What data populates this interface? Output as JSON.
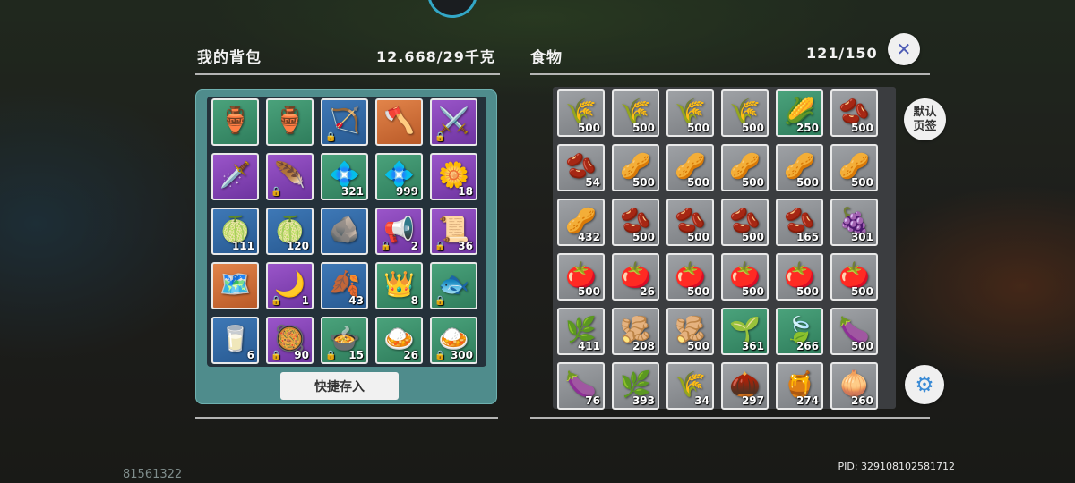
{
  "bag": {
    "title": "我的背包",
    "weight": "12.668/29千克",
    "quick_store_label": "快捷存入",
    "items": [
      {
        "name": "waterskin-icon",
        "icon": "🏺",
        "bg": "green",
        "count": "",
        "lock": false
      },
      {
        "name": "waterskin-icon",
        "icon": "🏺",
        "bg": "green",
        "count": "",
        "lock": false
      },
      {
        "name": "bow-icon",
        "icon": "🏹",
        "bg": "blue",
        "count": "",
        "lock": true
      },
      {
        "name": "axe-icon",
        "icon": "🪓",
        "bg": "orange",
        "count": "",
        "lock": false
      },
      {
        "name": "scythe-icon",
        "icon": "⚔️",
        "bg": "purple",
        "count": "",
        "lock": true
      },
      {
        "name": "crossbow-icon",
        "icon": "🗡️",
        "bg": "purple",
        "count": "",
        "lock": false
      },
      {
        "name": "feather-blade-icon",
        "icon": "🪶",
        "bg": "purple",
        "count": "",
        "lock": true
      },
      {
        "name": "green-gem-icon",
        "icon": "💠",
        "bg": "green",
        "count": "321",
        "lock": false
      },
      {
        "name": "green-gem-icon",
        "icon": "💠",
        "bg": "green",
        "count": "999",
        "lock": false
      },
      {
        "name": "yellow-flower-icon",
        "icon": "🌼",
        "bg": "purple",
        "count": "18",
        "lock": false
      },
      {
        "name": "gray-melon-icon",
        "icon": "🍈",
        "bg": "blue",
        "count": "111",
        "lock": false
      },
      {
        "name": "cantaloupe-icon",
        "icon": "🍈",
        "bg": "blue",
        "count": "120",
        "lock": false
      },
      {
        "name": "stone-icon",
        "icon": "🪨",
        "bg": "blue",
        "count": "",
        "lock": false
      },
      {
        "name": "megaphone-icon",
        "icon": "📢",
        "bg": "purple",
        "count": "2",
        "lock": true
      },
      {
        "name": "scroll-icon",
        "icon": "📜",
        "bg": "purple",
        "count": "36",
        "lock": true
      },
      {
        "name": "treasure-map-icon",
        "icon": "🗺️",
        "bg": "orange",
        "count": "",
        "lock": false
      },
      {
        "name": "sickle-icon",
        "icon": "🌙",
        "bg": "purple",
        "count": "1",
        "lock": true
      },
      {
        "name": "leaf-icon",
        "icon": "🍂",
        "bg": "blue",
        "count": "43",
        "lock": false
      },
      {
        "name": "thorn-crown-icon",
        "icon": "👑",
        "bg": "green",
        "count": "8",
        "lock": false
      },
      {
        "name": "blue-fish-icon",
        "icon": "🐟",
        "bg": "green",
        "count": "",
        "lock": true
      },
      {
        "name": "milk-bottle-icon",
        "icon": "🥛",
        "bg": "blue",
        "count": "6",
        "lock": false
      },
      {
        "name": "stew-bowl-icon",
        "icon": "🥘",
        "bg": "purple",
        "count": "90",
        "lock": true
      },
      {
        "name": "soup-bowl-icon",
        "icon": "🍲",
        "bg": "green",
        "count": "15",
        "lock": true
      },
      {
        "name": "curry-bowl-icon",
        "icon": "🍛",
        "bg": "green",
        "count": "26",
        "lock": false
      },
      {
        "name": "curry-bowl-icon",
        "icon": "🍛",
        "bg": "green",
        "count": "300",
        "lock": true
      }
    ]
  },
  "food": {
    "title": "食物",
    "capacity": "121/150",
    "default_tab_label": "默认页签",
    "items": [
      {
        "name": "wheat-icon",
        "icon": "🌾",
        "bg": "gray",
        "count": "500"
      },
      {
        "name": "wheat-icon",
        "icon": "🌾",
        "bg": "gray",
        "count": "500"
      },
      {
        "name": "wheat-icon",
        "icon": "🌾",
        "bg": "gray",
        "count": "500"
      },
      {
        "name": "wheat-icon",
        "icon": "🌾",
        "bg": "gray",
        "count": "500"
      },
      {
        "name": "corn-icon",
        "icon": "🌽",
        "bg": "green",
        "count": "250"
      },
      {
        "name": "red-beans-plate-icon",
        "icon": "🫘",
        "bg": "gray",
        "count": "500"
      },
      {
        "name": "red-beans-plate-icon",
        "icon": "🫘",
        "bg": "gray",
        "count": "54"
      },
      {
        "name": "soybeans-plate-icon",
        "icon": "🥜",
        "bg": "gray",
        "count": "500"
      },
      {
        "name": "soybeans-plate-icon",
        "icon": "🥜",
        "bg": "gray",
        "count": "500"
      },
      {
        "name": "soybeans-plate-icon",
        "icon": "🥜",
        "bg": "gray",
        "count": "500"
      },
      {
        "name": "soybeans-plate-icon",
        "icon": "🥜",
        "bg": "gray",
        "count": "500"
      },
      {
        "name": "soybeans-plate-icon",
        "icon": "🥜",
        "bg": "gray",
        "count": "500"
      },
      {
        "name": "soybeans-plate-icon",
        "icon": "🥜",
        "bg": "gray",
        "count": "432"
      },
      {
        "name": "red-beans-plate-icon",
        "icon": "🫘",
        "bg": "gray",
        "count": "500"
      },
      {
        "name": "red-beans-plate-icon",
        "icon": "🫘",
        "bg": "gray",
        "count": "500"
      },
      {
        "name": "red-beans-plate-icon",
        "icon": "🫘",
        "bg": "gray",
        "count": "500"
      },
      {
        "name": "red-beans-plate-icon",
        "icon": "🫘",
        "bg": "gray",
        "count": "165"
      },
      {
        "name": "grapes-icon",
        "icon": "🍇",
        "bg": "gray",
        "count": "301"
      },
      {
        "name": "tomato-icon",
        "icon": "🍅",
        "bg": "gray",
        "count": "500"
      },
      {
        "name": "tomato-icon",
        "icon": "🍅",
        "bg": "gray",
        "count": "26"
      },
      {
        "name": "tomato-icon",
        "icon": "🍅",
        "bg": "gray",
        "count": "500"
      },
      {
        "name": "tomato-icon",
        "icon": "🍅",
        "bg": "gray",
        "count": "500"
      },
      {
        "name": "tomato-icon",
        "icon": "🍅",
        "bg": "gray",
        "count": "500"
      },
      {
        "name": "tomato-icon",
        "icon": "🍅",
        "bg": "gray",
        "count": "500"
      },
      {
        "name": "lemongrass-icon",
        "icon": "🌿",
        "bg": "gray",
        "count": "411"
      },
      {
        "name": "ginger-icon",
        "icon": "🫚",
        "bg": "gray",
        "count": "208"
      },
      {
        "name": "ginger-icon",
        "icon": "🫚",
        "bg": "gray",
        "count": "500"
      },
      {
        "name": "mint-icon",
        "icon": "🌱",
        "bg": "green",
        "count": "361"
      },
      {
        "name": "basil-icon",
        "icon": "🍃",
        "bg": "green",
        "count": "266"
      },
      {
        "name": "eggplant-icon",
        "icon": "🍆",
        "bg": "gray",
        "count": "500"
      },
      {
        "name": "eggplant-icon",
        "icon": "🍆",
        "bg": "gray",
        "count": "76"
      },
      {
        "name": "herb-leaves-icon",
        "icon": "🌿",
        "bg": "gray",
        "count": "393"
      },
      {
        "name": "chives-icon",
        "icon": "🌾",
        "bg": "gray",
        "count": "34"
      },
      {
        "name": "pinecone-icon",
        "icon": "🌰",
        "bg": "gray",
        "count": "297"
      },
      {
        "name": "honeycomb-icon",
        "icon": "🍯",
        "bg": "gray",
        "count": "274"
      },
      {
        "name": "onion-icon",
        "icon": "🧅",
        "bg": "gray",
        "count": "260"
      }
    ]
  },
  "footer": {
    "left_id": "81561322",
    "pid": "PID: 329108102581712"
  },
  "icons": {
    "close": "✕",
    "sort": "⚙"
  }
}
